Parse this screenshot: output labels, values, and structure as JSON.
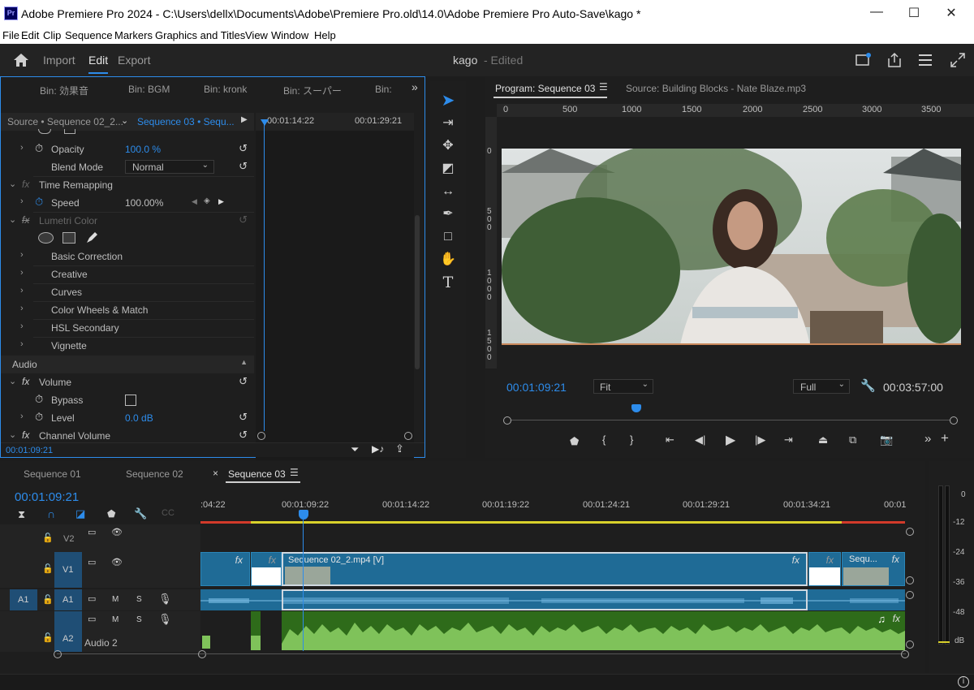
{
  "window": {
    "title": "Adobe Premiere Pro 2024 - C:\\Users\\dellx\\Documents\\Adobe\\Premiere Pro.old\\14.0\\Adobe Premiere Pro Auto-Save\\kago *",
    "app_badge": "Pr"
  },
  "menu": [
    "File",
    "Edit",
    "Clip",
    "Sequence",
    "Markers",
    "Graphics and Titles",
    "View",
    "Window",
    "Help"
  ],
  "header": {
    "tabs": [
      "Import",
      "Edit",
      "Export"
    ],
    "project": "kago",
    "status": "- Edited"
  },
  "bins": [
    "Bin: 効果音",
    "Bin: BGM",
    "Bin: kronk",
    "Bin: スーパー",
    "Bin:"
  ],
  "effect_controls": {
    "source_tab": "Source • Sequence 02_2...",
    "seq_tab": "Sequence 03 • Sequ...",
    "tc_in": "00:01:14:22",
    "tc_out": "00:01:29:21",
    "current_tc": "00:01:09:21",
    "rows": {
      "opacity": "Opacity",
      "opacity_val": "100.0 %",
      "blend": "Blend Mode",
      "blend_val": "Normal",
      "time_remap": "Time Remapping",
      "speed": "Speed",
      "speed_val": "100.00%",
      "lumetri": "Lumetri Color",
      "basic": "Basic Correction",
      "creative": "Creative",
      "curves": "Curves",
      "wheels": "Color Wheels & Match",
      "hsl": "HSL Secondary",
      "vignette": "Vignette",
      "audio": "Audio",
      "volume": "Volume",
      "bypass": "Bypass",
      "level": "Level",
      "level_val": "0.0 dB",
      "channel": "Channel Volume"
    }
  },
  "program": {
    "tab": "Program: Sequence 03",
    "source_tab": "Source: Building Blocks - Nate Blaze.mp3",
    "ruler": [
      "0",
      "500",
      "1000",
      "1500",
      "2000",
      "2500",
      "3000",
      "3500"
    ],
    "vruler": [
      "0",
      "5\n0\n0",
      "1\n0\n0\n0",
      "1\n5\n0\n0"
    ],
    "current_tc": "00:01:09:21",
    "fit": "Fit",
    "quality": "Full",
    "duration": "00:03:57:00"
  },
  "timeline": {
    "tabs": [
      "Sequence 01",
      "Sequence 02",
      "Sequence 03"
    ],
    "current_tc": "00:01:09:21",
    "ruler": [
      ":04:22",
      "00:01:09:22",
      "00:01:14:22",
      "00:01:19:22",
      "00:01:24:21",
      "00:01:29:21",
      "00:01:34:21",
      "00:01"
    ],
    "tracks": {
      "v2": "V2",
      "v1": "V1",
      "a1_src": "A1",
      "a1": "A1",
      "a2": "A2",
      "a2_name": "Audio 2",
      "m": "M",
      "s": "S"
    },
    "clip_main": "Sequence 02_2.mp4 [V]",
    "clip_right": "Sequ...",
    "fx": "fx"
  },
  "meters": {
    "scale": [
      "-12",
      "-24",
      "-36",
      "-48",
      "dB"
    ],
    "zero": "0"
  },
  "colors": {
    "accent": "#2d8ceb",
    "video_clip": "#1f6b96",
    "audio_clip": "#2e6b1a",
    "audio_wave": "#7fc25a"
  }
}
